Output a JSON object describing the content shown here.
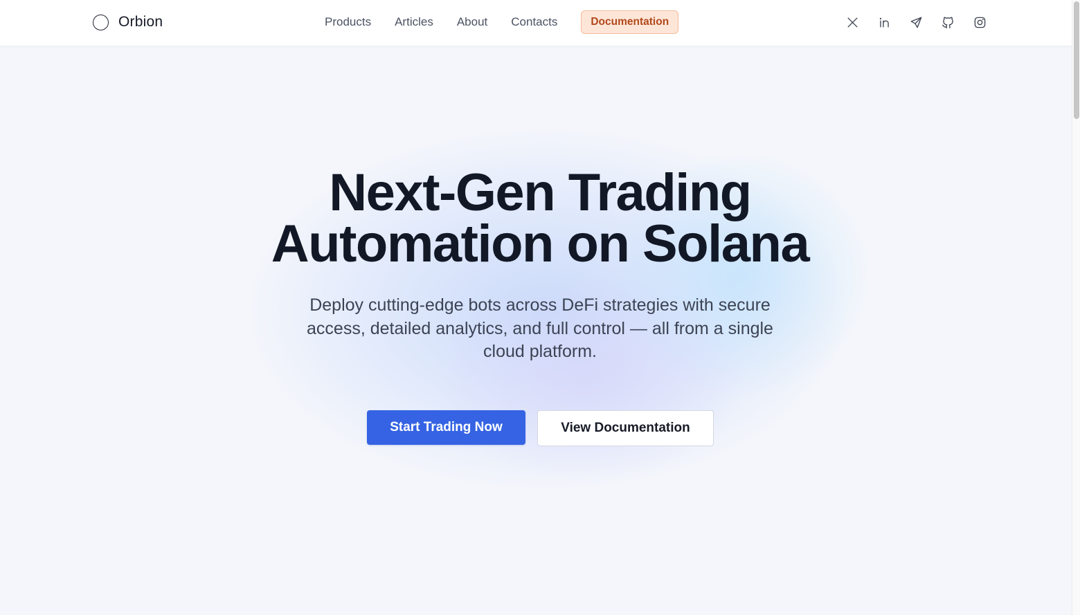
{
  "brand": {
    "name": "Orbion",
    "logo_icon": "circle-logo-icon"
  },
  "nav": {
    "items": [
      {
        "label": "Products"
      },
      {
        "label": "Articles"
      },
      {
        "label": "About"
      },
      {
        "label": "Contacts"
      }
    ],
    "cta_label": "Documentation"
  },
  "socials": [
    {
      "icon": "x-icon"
    },
    {
      "icon": "linkedin-icon"
    },
    {
      "icon": "telegram-icon"
    },
    {
      "icon": "github-icon"
    },
    {
      "icon": "instagram-icon"
    }
  ],
  "hero": {
    "title_line1": "Next-Gen Trading",
    "title_line2": "Automation on Solana",
    "subtitle": "Deploy cutting-edge bots across DeFi strategies with secure access, detailed analytics, and full control — all from a single cloud platform.",
    "primary_cta": "Start Trading Now",
    "secondary_cta": "View Documentation"
  },
  "colors": {
    "primary": "#3563e3",
    "docs_badge_bg": "#fde6d8",
    "docs_badge_text": "#b3491b",
    "heading": "#121826"
  }
}
